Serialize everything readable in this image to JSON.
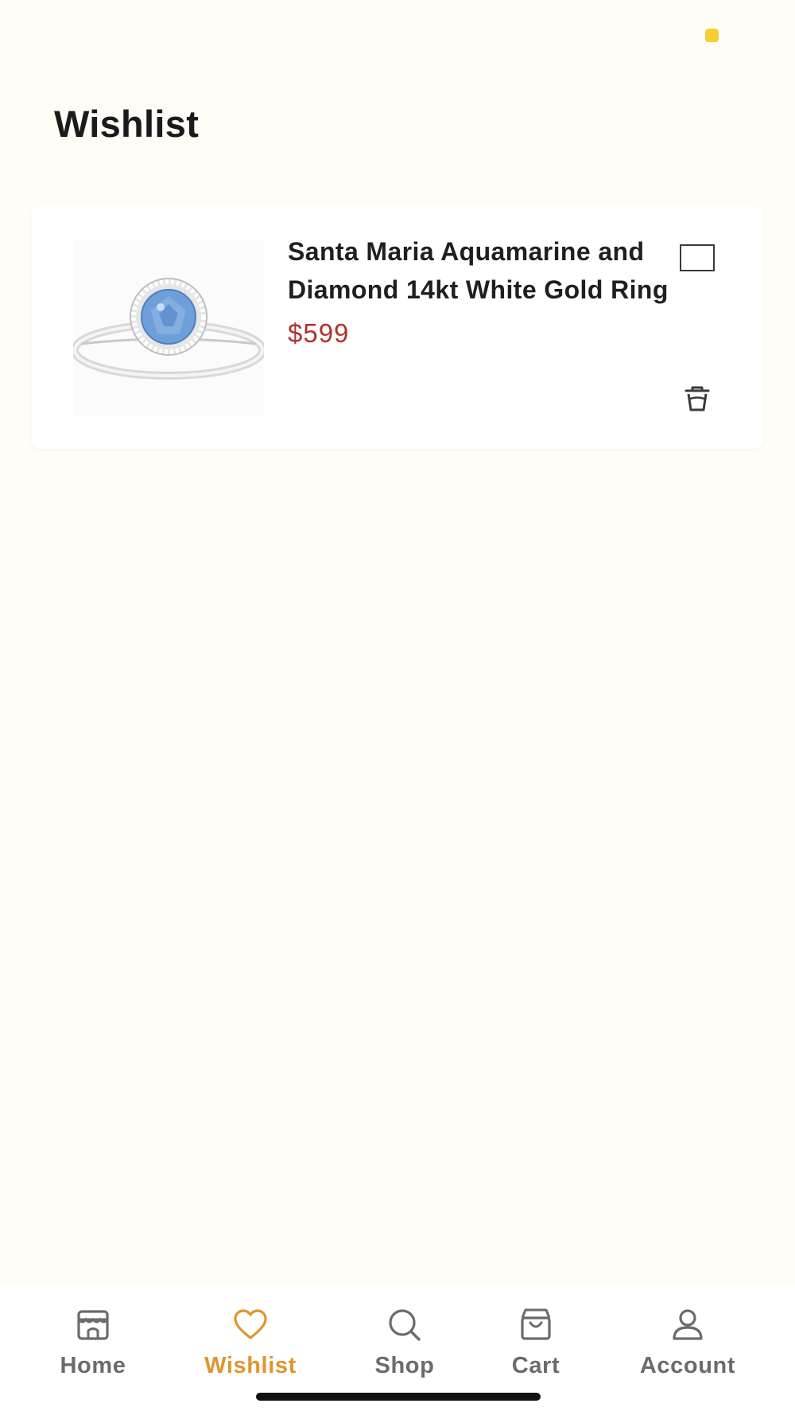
{
  "page": {
    "title": "Wishlist"
  },
  "colors": {
    "background": "#fffdf6",
    "accent": "#e0952f",
    "price": "#b0322c",
    "status_dot": "#f5d033"
  },
  "wishlist": {
    "items": [
      {
        "name": "Santa Maria Aquamarine and Diamond 14kt White Gold Ring",
        "price": "$599",
        "selected": false
      }
    ]
  },
  "nav": {
    "items": [
      {
        "label": "Home",
        "icon": "storefront-icon",
        "active": false
      },
      {
        "label": "Wishlist",
        "icon": "heart-icon",
        "active": true
      },
      {
        "label": "Shop",
        "icon": "search-icon",
        "active": false
      },
      {
        "label": "Cart",
        "icon": "shopping-bag-icon",
        "active": false
      },
      {
        "label": "Account",
        "icon": "user-icon",
        "active": false
      }
    ]
  }
}
